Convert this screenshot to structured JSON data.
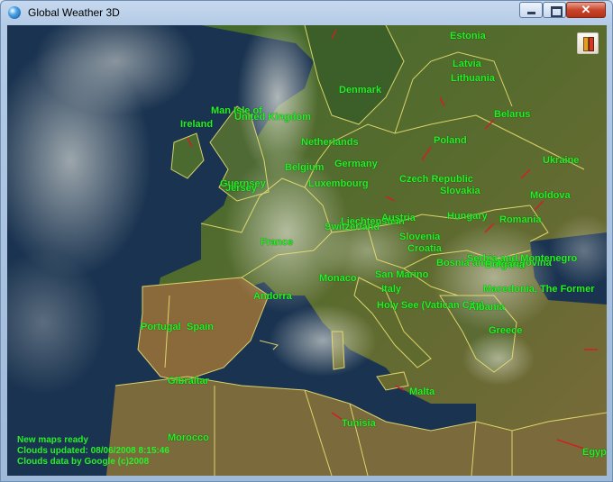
{
  "window": {
    "title": "Global Weather 3D",
    "controls": {
      "minimize": "minimize",
      "maximize": "maximize",
      "close": "✕"
    }
  },
  "toolbar": {
    "settings_icon": "tools-icon"
  },
  "map": {
    "labels": {
      "estonia": "Estonia",
      "latvia": "Latvia",
      "lithuania": "Lithuania",
      "denmark": "Denmark",
      "belarus": "Belarus",
      "isle_of_man": "Man Isle of",
      "united_kingdom": "United Kingdom",
      "ireland": "Ireland",
      "netherlands": "Netherlands",
      "poland": "Poland",
      "germany": "Germany",
      "belgium": "Belgium",
      "ukraine": "Ukraine",
      "guernsey": "Guernsey",
      "jersey": "Jersey",
      "czech_republic": "Czech Republic",
      "luxembourg": "Luxembourg",
      "slovakia": "Slovakia",
      "moldova": "Moldova",
      "liechtenstein": "Liechtenstein",
      "austria": "Austria",
      "hungary": "Hungary",
      "romania": "Romania",
      "switzerland": "Switzerland",
      "slovenia": "Slovenia",
      "france": "France",
      "croatia": "Croatia",
      "bosnia": "Bosnia and Herzegovina",
      "serbia": "Serbia and Montenegro",
      "bulgaria": "Bulgaria",
      "monaco": "Monaco",
      "san_marino": "San Marino",
      "andorra": "Andorra",
      "italy": "Italy",
      "macedonia": "Macedonia, The Former",
      "holy_see": "Holy See (Vatican City)",
      "albania": "Albania",
      "portugal": "Portugal",
      "spain": "Spain",
      "greece": "Greece",
      "gibraltar": "Gibraltar",
      "malta": "Malta",
      "tunisia": "Tunisia",
      "morocco": "Morocco",
      "egypt": "Egypt"
    },
    "status": {
      "line1": "New maps ready",
      "line2": "Clouds updated: 08/06/2008 8:15:46",
      "line3": "Clouds data by Google (c)2008"
    }
  },
  "colors": {
    "label_green": "#28f028",
    "border_yellow": "#e8e070",
    "sea": "#142c48",
    "land": "#4a6a2a"
  }
}
